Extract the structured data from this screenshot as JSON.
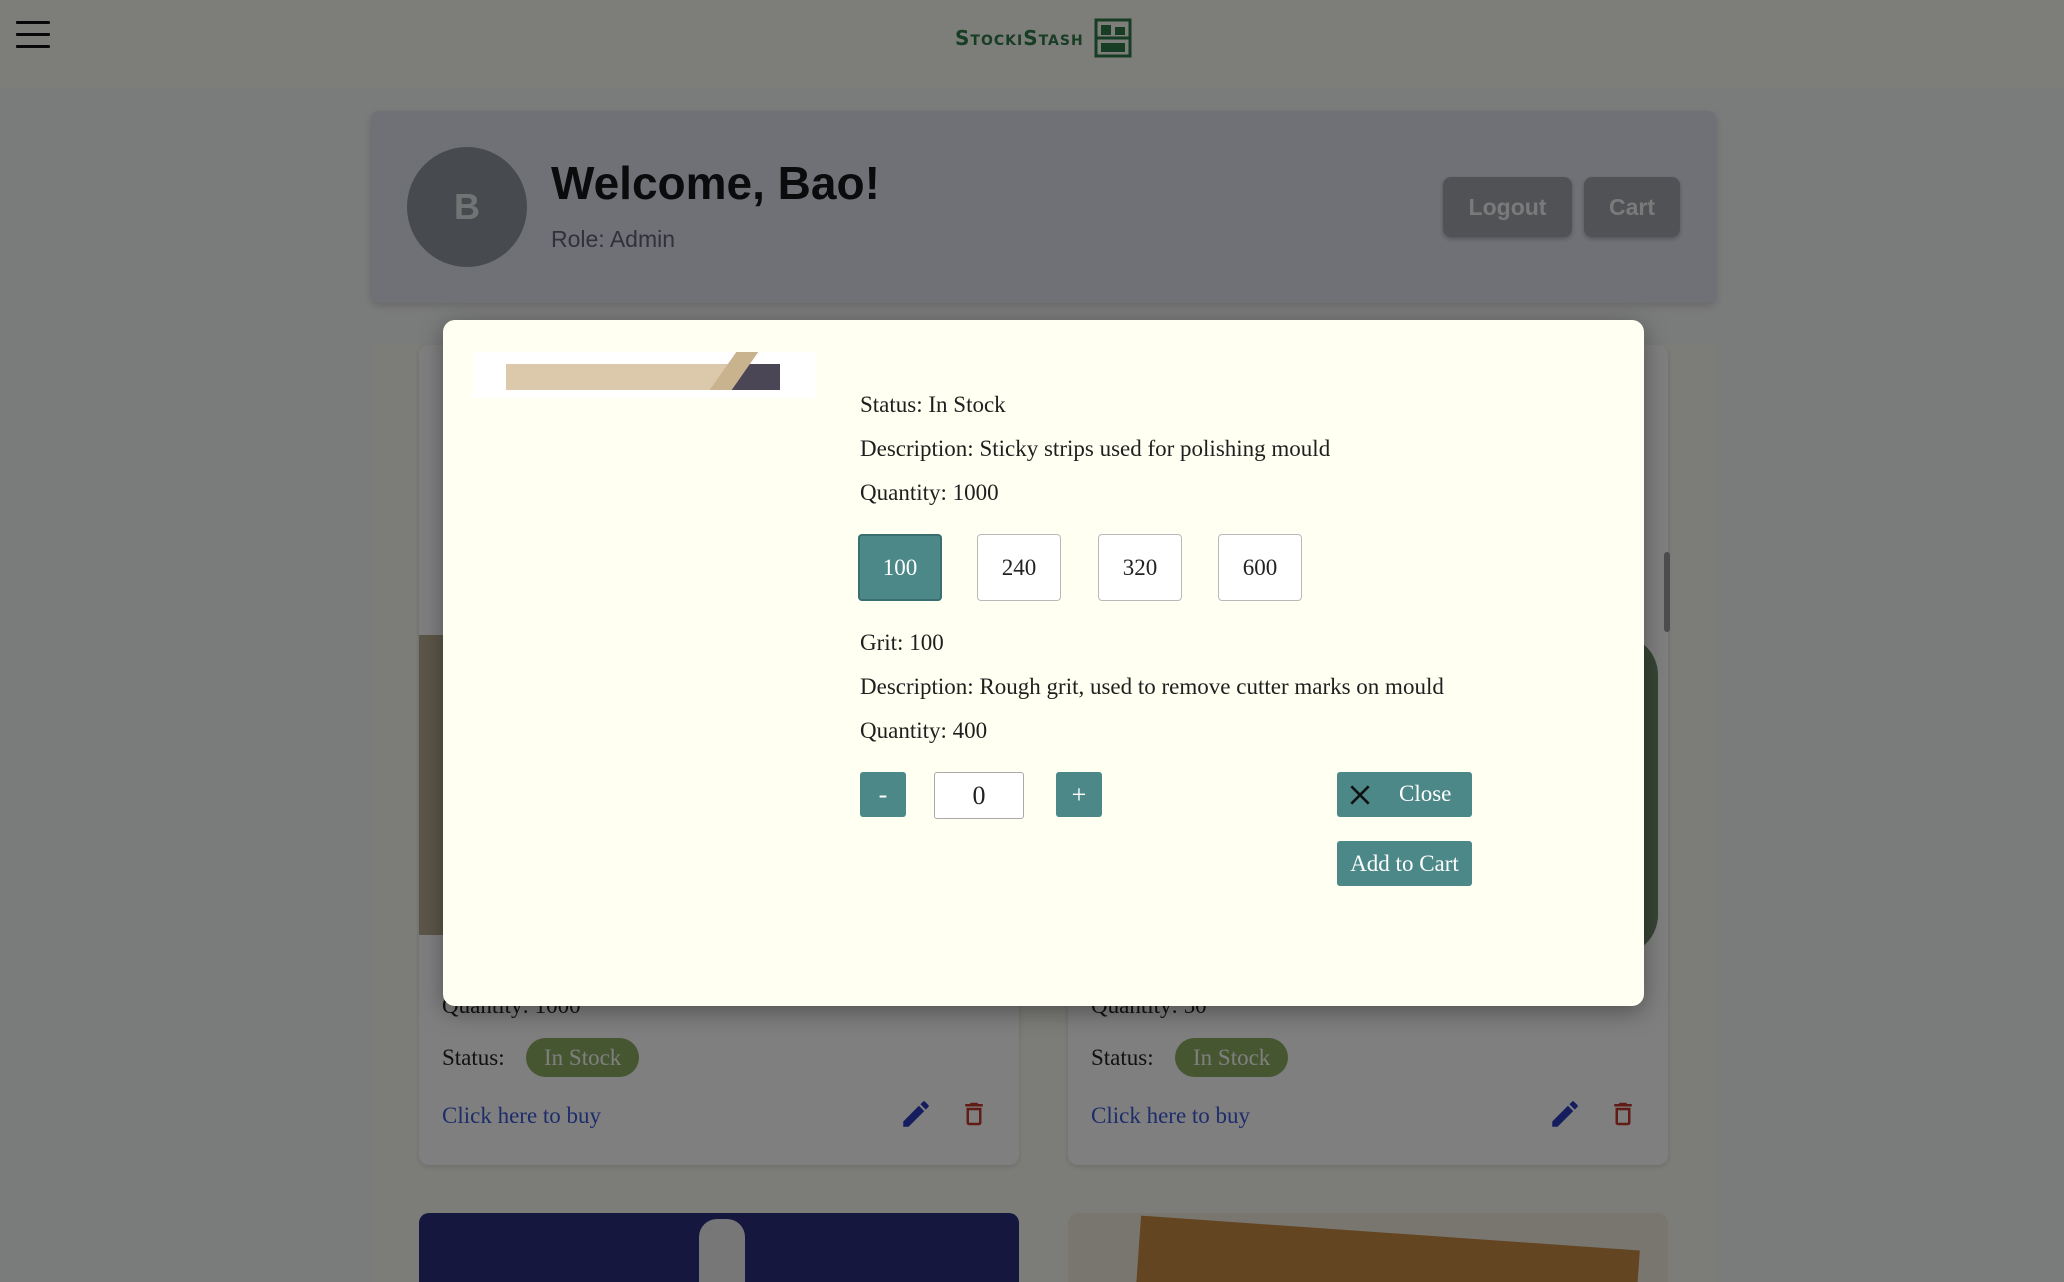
{
  "app": {
    "brand": "StockiStash",
    "brand_color": "#2f7a4b"
  },
  "header": {
    "avatar_initial": "B",
    "welcome": "Welcome, Bao!",
    "role": "Role: Admin",
    "logout_label": "Logout",
    "cart_label": "Cart"
  },
  "cards": [
    {
      "quantity": "Quantity: 1000",
      "status_label": "Status:",
      "status": "In Stock",
      "buy_link": "Click here to buy"
    },
    {
      "quantity": "Quantity: 50",
      "status_label": "Status:",
      "status": "In Stock",
      "buy_link": "Click here to buy"
    }
  ],
  "modal": {
    "status": "Status: In Stock",
    "description": "Description: Sticky strips used for polishing mould",
    "quantity": "Quantity: 1000",
    "grit_options": [
      "100",
      "240",
      "320",
      "600"
    ],
    "selected_grit": "100",
    "grit": "Grit: 100",
    "grit_description": "Description: Rough grit, used to remove cutter marks on mould",
    "grit_quantity": "Quantity: 400",
    "minus_label": "-",
    "plus_label": "+",
    "qty_value": "0",
    "close_label": "Close",
    "add_to_cart_label": "Add to Cart",
    "accent_color": "#4d8888"
  },
  "icons": {
    "menu": "hamburger-menu-icon",
    "logo": "shelf-icon",
    "edit": "pencil-icon",
    "delete": "trash-icon",
    "close": "close-x-icon"
  }
}
